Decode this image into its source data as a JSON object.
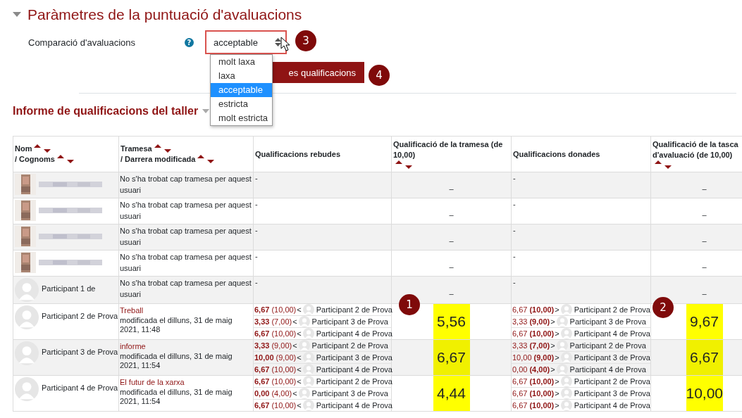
{
  "section": {
    "title": "Paràmetres de la puntuació d'avaluacions",
    "expanded": true
  },
  "comparison": {
    "label": "Comparació d'avaluacions",
    "help": "?",
    "value": "acceptable",
    "open": true,
    "options": [
      {
        "label": "molt laxa",
        "selected": false
      },
      {
        "label": "laxa",
        "selected": false
      },
      {
        "label": "acceptable",
        "selected": true
      },
      {
        "label": "estricta",
        "selected": false
      },
      {
        "label": "molt estricta",
        "selected": false
      }
    ]
  },
  "recalculate_button": {
    "label": "es qualificacions"
  },
  "report": {
    "title": "Informe de qualificacions del taller"
  },
  "annotations": [
    {
      "label": "1"
    },
    {
      "label": "2"
    },
    {
      "label": "3"
    },
    {
      "label": "4"
    }
  ],
  "table": {
    "columns": [
      {
        "parts": [
          {
            "label": "Nom",
            "sortable": true
          },
          {
            "label": "/ Cognoms",
            "sortable": true
          }
        ]
      },
      {
        "parts": [
          {
            "label": "Tramesa",
            "sortable": true
          },
          {
            "label": "/ Darrera modificada",
            "sortable": true
          }
        ]
      },
      {
        "parts": [
          {
            "label": "Qualificacions rebudes",
            "sortable": false
          }
        ]
      },
      {
        "parts": [
          {
            "label": "Qualificació de la tramesa (de 10,00)",
            "sortable": true
          }
        ]
      },
      {
        "parts": [
          {
            "label": "Qualificacions donades",
            "sortable": false
          }
        ]
      },
      {
        "parts": [
          {
            "label": "Qualificació de la tasca d'avaluació (de 10,00)",
            "sortable": true
          }
        ]
      }
    ],
    "rows": [
      {
        "kind": "hidden",
        "submission": {
          "text": "No s'ha trobat cap tramesa per aquest usuari"
        },
        "received": "-",
        "submission_grade": {
          "value": "–",
          "highlighted": false
        },
        "given": "-",
        "assessment_grade": {
          "value": "–",
          "highlighted": false
        }
      },
      {
        "kind": "hidden",
        "submission": {
          "text": "No s'ha trobat cap tramesa per aquest usuari"
        },
        "received": "-",
        "submission_grade": {
          "value": "–",
          "highlighted": false
        },
        "given": "-",
        "assessment_grade": {
          "value": "–",
          "highlighted": false
        }
      },
      {
        "kind": "hidden",
        "submission": {
          "text": "No s'ha trobat cap tramesa per aquest usuari"
        },
        "received": "-",
        "submission_grade": {
          "value": "–",
          "highlighted": false
        },
        "given": "-",
        "assessment_grade": {
          "value": "–",
          "highlighted": false
        }
      },
      {
        "kind": "hidden",
        "submission": {
          "text": "No s'ha trobat cap tramesa per aquest usuari"
        },
        "received": "-",
        "submission_grade": {
          "value": "–",
          "highlighted": false
        },
        "given": "-",
        "assessment_grade": {
          "value": "–",
          "highlighted": false
        }
      },
      {
        "kind": "participant",
        "name": "Participant 1 de",
        "submission": {
          "text": "No s'ha trobat cap tramesa per aquest usuari"
        },
        "received": "-",
        "submission_grade": {
          "value": "–",
          "highlighted": false
        },
        "given": "-",
        "assessment_grade": {
          "value": "–",
          "highlighted": false
        }
      },
      {
        "kind": "participant",
        "name": "Participant 2 de Prova",
        "submission": {
          "title": "Treball",
          "modified": "modificada el dilluns, 31 de maig 2021, 11:48"
        },
        "received": [
          {
            "grade": "6,67",
            "reference": "(10,00)",
            "arrow": "<",
            "participant": "Participant 2 de Prova"
          },
          {
            "grade": "3,33",
            "reference": "(7,00)",
            "arrow": "<",
            "participant": "Participant 3 de Prova"
          },
          {
            "grade": "6,67",
            "reference": "(10,00)",
            "arrow": "<",
            "participant": "Participant 4 de Prova"
          }
        ],
        "submission_grade": {
          "value": "5,56",
          "highlighted": true
        },
        "given": [
          {
            "grade": "6,67",
            "reference": "(10,00)",
            "arrow": ">",
            "participant": "Participant 2 de Prova"
          },
          {
            "grade": "3,33",
            "reference": "(9,00)",
            "arrow": ">",
            "participant": "Participant 3 de Prova"
          },
          {
            "grade": "6,67",
            "reference": "(10,00)",
            "arrow": ">",
            "participant": "Participant 4 de Prova"
          }
        ],
        "assessment_grade": {
          "value": "9,67",
          "highlighted": true
        }
      },
      {
        "kind": "participant",
        "name": "Participant 3 de Prova",
        "submission": {
          "title": "informe",
          "modified": "modificada el dilluns, 31 de maig 2021, 11:54"
        },
        "received": [
          {
            "grade": "3,33",
            "reference": "(9,00)",
            "arrow": "<",
            "participant": "Participant 2 de Prova"
          },
          {
            "grade": "10,00",
            "reference": "(9,00)",
            "arrow": "<",
            "participant": "Participant 3 de Prova"
          },
          {
            "grade": "6,67",
            "reference": "(10,00)",
            "arrow": "<",
            "participant": "Participant 4 de Prova"
          }
        ],
        "submission_grade": {
          "value": "6,67",
          "highlighted": true
        },
        "given": [
          {
            "grade": "3,33",
            "reference": "(7,00)",
            "arrow": ">",
            "participant": "Participant 2 de Prova"
          },
          {
            "grade": "10,00",
            "reference": "(9,00)",
            "arrow": ">",
            "participant": "Participant 3 de Prova"
          },
          {
            "grade": "0,00",
            "reference": "(4,00)",
            "arrow": ">",
            "participant": "Participant 4 de Prova"
          }
        ],
        "assessment_grade": {
          "value": "6,67",
          "highlighted": true
        }
      },
      {
        "kind": "participant",
        "name": "Participant 4 de Prova",
        "submission": {
          "title": "El futur de la xarxa",
          "modified": "modificada el dilluns, 31 de maig 2021, 11:54"
        },
        "received": [
          {
            "grade": "6,67",
            "reference": "(10,00)",
            "arrow": "<",
            "participant": "Participant 2 de Prova"
          },
          {
            "grade": "0,00",
            "reference": "(4,00)",
            "arrow": "<",
            "participant": "Participant 3 de Prova"
          },
          {
            "grade": "6,67",
            "reference": "(10,00)",
            "arrow": "<",
            "participant": "Participant 4 de Prova"
          }
        ],
        "submission_grade": {
          "value": "4,44",
          "highlighted": true
        },
        "given": [
          {
            "grade": "6,67",
            "reference": "(10,00)",
            "arrow": ">",
            "participant": "Participant 2 de Prova"
          },
          {
            "grade": "6,67",
            "reference": "(10,00)",
            "arrow": ">",
            "participant": "Participant 3 de Prova"
          },
          {
            "grade": "6,67",
            "reference": "(10,00)",
            "arrow": ">",
            "participant": "Participant 4 de Prova"
          }
        ],
        "assessment_grade": {
          "value": "10,00",
          "highlighted": true
        }
      }
    ]
  }
}
